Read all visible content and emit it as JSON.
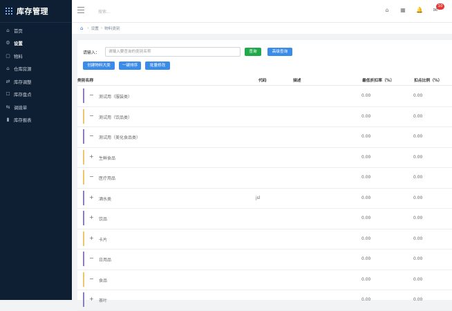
{
  "app": {
    "title": "库存管理"
  },
  "sidebar": {
    "items": [
      {
        "label": "首页",
        "icon": "home-icon",
        "active": false
      },
      {
        "label": "设置",
        "icon": "gear-icon",
        "active": true
      },
      {
        "label": "物料",
        "icon": "box-icon",
        "active": false
      },
      {
        "label": "仓库房源",
        "icon": "warehouse-icon",
        "active": false
      },
      {
        "label": "库存调整",
        "icon": "adjust-icon",
        "active": false
      },
      {
        "label": "库存盘点",
        "icon": "clipboard-icon",
        "active": false
      },
      {
        "label": "调拨单",
        "icon": "transfer-icon",
        "active": false
      },
      {
        "label": "库存报表",
        "icon": "bar-chart-icon",
        "active": false
      }
    ]
  },
  "topbar": {
    "search_placeholder": "搜索...",
    "notification_count": "10"
  },
  "breadcrumb": {
    "items": [
      "设置",
      "物料类别"
    ]
  },
  "query": {
    "label": "请输入：",
    "placeholder": "请输入要查询的类别名称",
    "search_button": "查询",
    "advanced_button": "高级查询"
  },
  "actions": {
    "create": "创建物料大类",
    "sort": "一键排序",
    "batch_edit": "批量修改"
  },
  "table": {
    "headers": {
      "name": "类别名称",
      "code": "代码",
      "desc": "描述",
      "max_discount": "最低折扣率（%）",
      "commission": "扣点比例（%）"
    },
    "rows": [
      {
        "name": "测试用（服装类）",
        "code": "",
        "toggle": "−",
        "bar_color": "#8e7cc3",
        "v1": "0.00",
        "v2": "0.00"
      },
      {
        "name": "测试用（饮品类）",
        "code": "",
        "toggle": "−",
        "bar_color": "#f0c36d",
        "v1": "0.00",
        "v2": "0.00"
      },
      {
        "name": "测试用（美化食品类）",
        "code": "",
        "toggle": "−",
        "bar_color": "#8e7cc3",
        "v1": "0.00",
        "v2": "0.00"
      },
      {
        "name": "生鲜食品",
        "code": "",
        "toggle": "+",
        "bar_color": "#f0c36d",
        "v1": "0.00",
        "v2": "0.00"
      },
      {
        "name": "医疗用品",
        "code": "",
        "toggle": "−",
        "bar_color": "#f0c36d",
        "v1": "0.00",
        "v2": "0.00"
      },
      {
        "name": "酒水类",
        "code": "jsl",
        "toggle": "+",
        "bar_color": "#8e7cc3",
        "v1": "0.00",
        "v2": "0.00"
      },
      {
        "name": "饮品",
        "code": "",
        "toggle": "+",
        "bar_color": "#8e7cc3",
        "v1": "0.00",
        "v2": "0.00"
      },
      {
        "name": "卡片",
        "code": "",
        "toggle": "+",
        "bar_color": "#f0c36d",
        "v1": "0.00",
        "v2": "0.00"
      },
      {
        "name": "日用品",
        "code": "",
        "toggle": "−",
        "bar_color": "#8e7cc3",
        "v1": "0.00",
        "v2": "0.00"
      },
      {
        "name": "食品",
        "code": "",
        "toggle": "−",
        "bar_color": "#f0c36d",
        "v1": "0.00",
        "v2": "0.00"
      },
      {
        "name": "茶叶",
        "code": "",
        "toggle": "+",
        "bar_color": "#8e7cc3",
        "v1": "0.00",
        "v2": "0.00"
      }
    ]
  }
}
